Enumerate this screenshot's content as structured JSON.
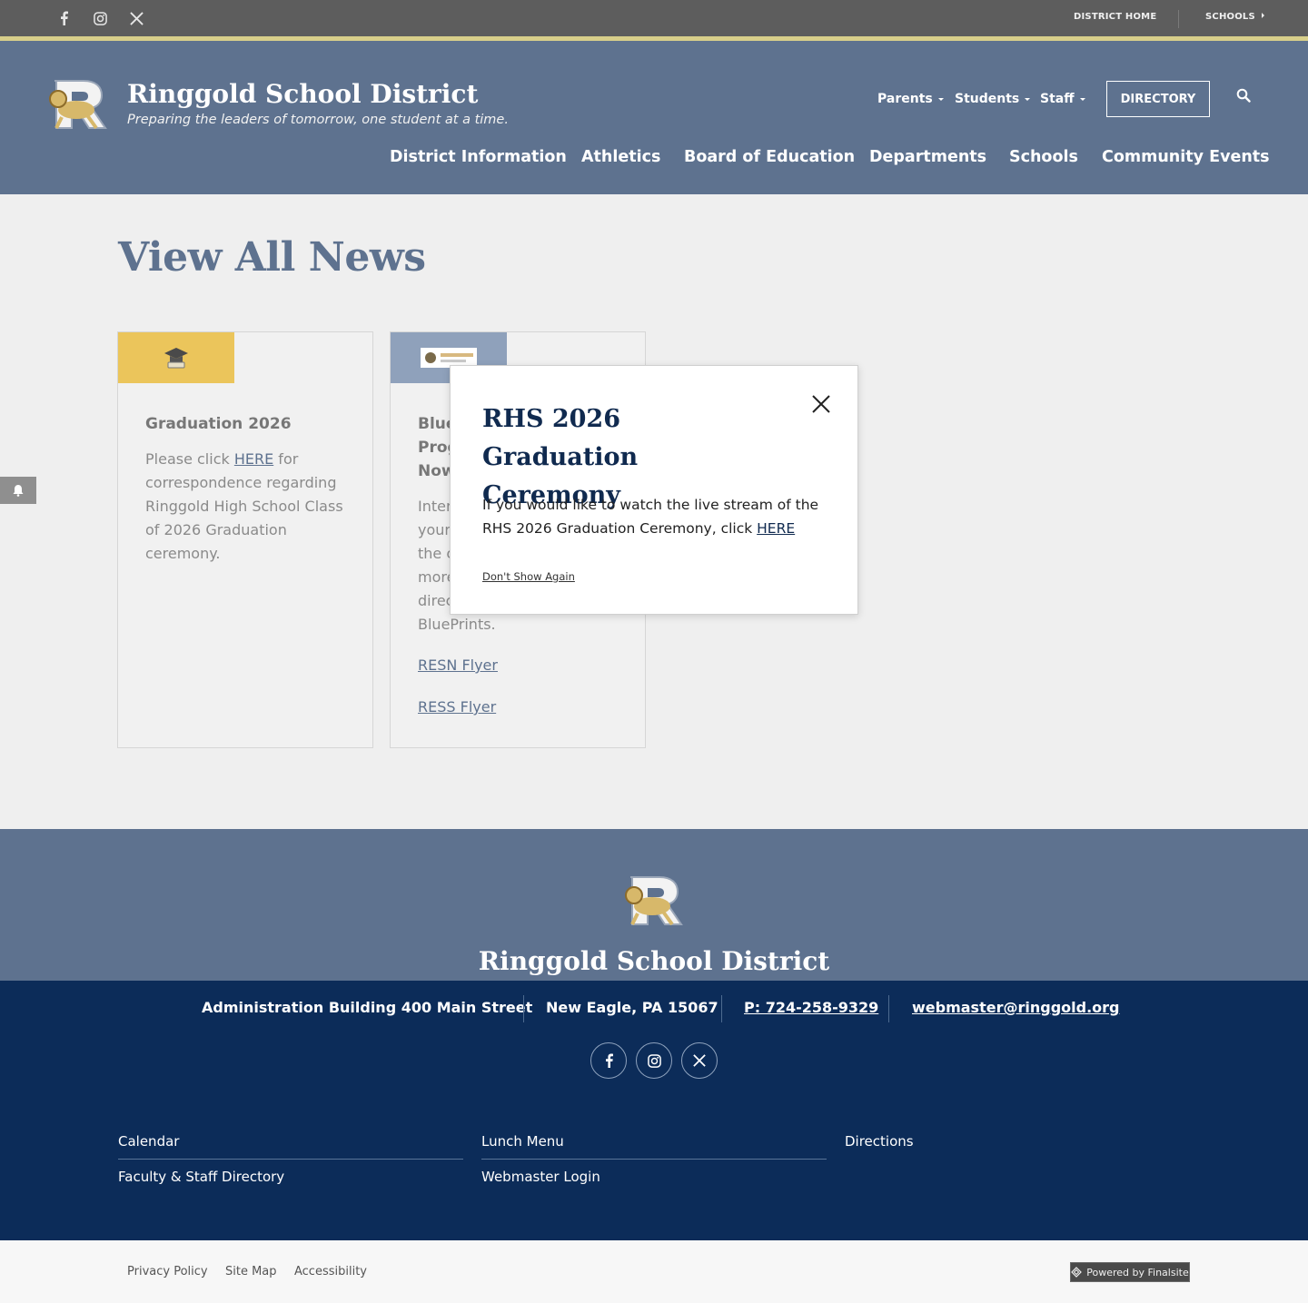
{
  "utility_bar": {
    "social": [
      "facebook-icon",
      "instagram-icon",
      "x-icon"
    ],
    "district_home": "DISTRICT HOME",
    "schools": "SCHOOLS"
  },
  "header": {
    "title": "Ringgold School District",
    "tagline": "Preparing the leaders of tomorrow, one student at a time.",
    "utility_nav": [
      "Parents",
      "Students",
      "Staff"
    ],
    "directory_label": "DIRECTORY",
    "main_nav": [
      "District Information",
      "Athletics",
      "Board of Education",
      "Departments",
      "Schools",
      "Community Events"
    ]
  },
  "main": {
    "page_title": "View All News",
    "cards": [
      {
        "title": "Graduation 2026",
        "text_before": "Please click ",
        "link": "HERE",
        "text_after": " for correspondence regarding Ringgold High School Class of 2026 Graduation ceremony."
      },
      {
        "title_lines": [
          "Blue",
          "Prog",
          "Now"
        ],
        "text_lines": [
          "Inter",
          "your",
          "the c",
          "more",
          "direc",
          "BluePrints."
        ],
        "links": [
          "RESN Flyer",
          "RESS Flyer"
        ]
      }
    ]
  },
  "modal": {
    "title": "RHS 2026 Graduation Ceremony",
    "body": "If you would like to watch the live stream of the RHS 2026 Graduation Ceremony, click ",
    "body_link": "HERE",
    "dont_show": "Don't Show Again"
  },
  "footer": {
    "name": "Ringgold School District",
    "address": "Administration Building 400 Main Street",
    "city": "New Eagle, PA  15067",
    "phone": "P: 724-258-9329",
    "email": "webmaster@ringgold.org",
    "links": [
      "Calendar",
      "Lunch Menu",
      "Directions",
      "Faculty & Staff Directory",
      "Webmaster Login"
    ],
    "bottom_links": [
      "Privacy Policy",
      "Site Map",
      "Accessibility"
    ],
    "powered_by": "Powered by Finalsite"
  },
  "colors": {
    "header_blue": "#5e728f",
    "footer_navy": "#0c2c59",
    "accent_gold": "#ebc55b",
    "utility_gray": "#5d5d5d"
  }
}
